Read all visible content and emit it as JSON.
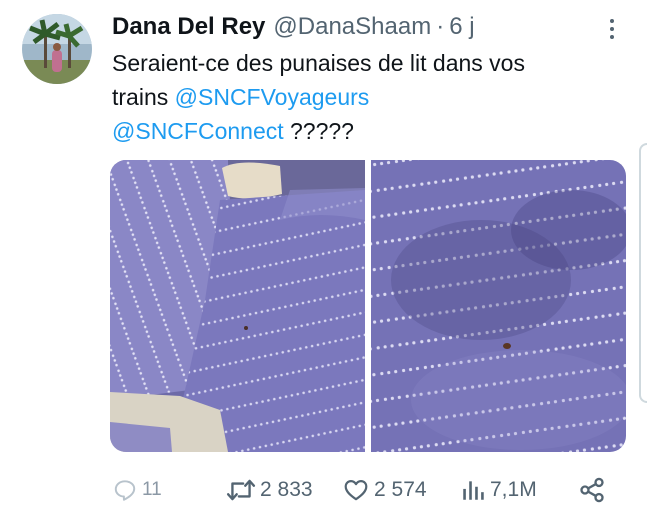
{
  "tweet": {
    "author": {
      "display_name": "Dana Del Rey",
      "handle": "@DanaShaam",
      "separator": "·",
      "time": "6 j"
    },
    "text": {
      "line1": "Seraient-ce des punaises de lit dans vos",
      "line2_prefix": "trains ",
      "mention1": "@SNCFVoyageurs",
      "mention2": "@SNCFConnect",
      "line3_suffix": " ?????"
    },
    "media": [
      {
        "icon": "train-seat-photo"
      },
      {
        "icon": "seat-fabric-closeup-photo"
      }
    ],
    "actions": {
      "replies": "11",
      "retweets": "2 833",
      "likes": "2 574",
      "views": "7,1M"
    }
  },
  "colors": {
    "text": "#0f1419",
    "secondary": "#536471",
    "link": "#1d9bf0",
    "seat_fabric": "#7774b8"
  }
}
